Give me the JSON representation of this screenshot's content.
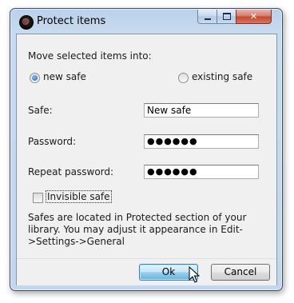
{
  "window": {
    "title": "Protect items",
    "controls": {
      "minimize": "minimize",
      "maximize": "maximize",
      "close": "✕"
    }
  },
  "form": {
    "move_label": "Move selected items into:",
    "options": [
      {
        "label": "new safe",
        "selected": true
      },
      {
        "label": "existing safe",
        "selected": false
      }
    ],
    "safe_label": "Safe:",
    "safe_value": "New safe",
    "password_label": "Password:",
    "password_value": "●●●●●●",
    "repeat_label": "Repeat password:",
    "repeat_value": "●●●●●●",
    "invisible_label": "Invisible safe",
    "invisible_checked": false,
    "info": "Safes are located in Protected section of your library. You may adjust it appearance in Edit->Settings->General"
  },
  "buttons": {
    "ok": "Ok",
    "cancel": "Cancel"
  },
  "colors": {
    "accent": "#3c7fb1",
    "close": "#c54530"
  }
}
